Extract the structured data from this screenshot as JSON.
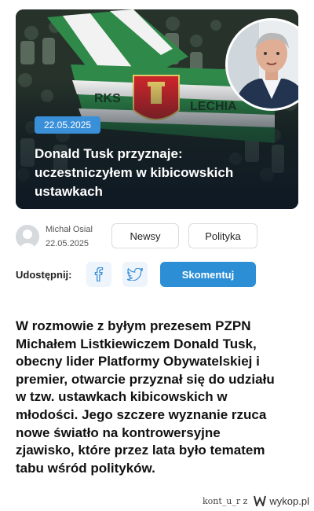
{
  "hero": {
    "date": "22.05.2025",
    "title": "Donald Tusk przyznaje: uczestniczyłem w kibicowskich ustawkach",
    "colors": {
      "badge": "#3a8fd9",
      "flag_green": "#2f8a4a",
      "flag_white": "#f2f2f2",
      "crest_red": "#c8262b"
    }
  },
  "author": {
    "name": "Michał Osial",
    "date": "22.05.2025"
  },
  "tags": [
    "Newsy",
    "Polityka"
  ],
  "share": {
    "label": "Udostępnij:",
    "facebook_icon": "facebook-icon",
    "twitter_icon": "twitter-icon",
    "comment_label": "Skomentuj",
    "accent": "#2c8fd6"
  },
  "article": {
    "lead": "W rozmowie z byłym prezesem PZPN Michałem Listkiewiczem Donald Tusk, obecny lider Platformy Obywatelskiej i premier, otwarcie przyznał się do udziału w tzw. ustawkach kibicowskich w młodości. Jego szczere wyznanie rzuca nowe światło na kontrowersyjne zjawisko, które przez lata było tematem tabu wśród polityków."
  },
  "watermark": {
    "user": "kont_u_r z",
    "site": "wykop.pl"
  }
}
